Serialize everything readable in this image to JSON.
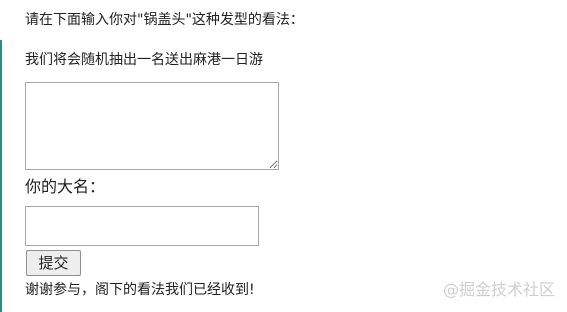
{
  "prompt_text": "请在下面输入你对\"锅盖头\"这种发型的看法：",
  "form": {
    "notice": "我们将会随机抽出一名送出麻港一日游",
    "comment_value": "",
    "name_label": "你的大名：",
    "name_value": "",
    "submit_label": "提交",
    "thanks_message": "谢谢参与，阁下的看法我们已经收到!"
  },
  "watermark": "@掘金技术社区",
  "colors": {
    "panel_border": "#2f8a8a",
    "text": "#222222",
    "watermark": "#cfcfcf"
  }
}
